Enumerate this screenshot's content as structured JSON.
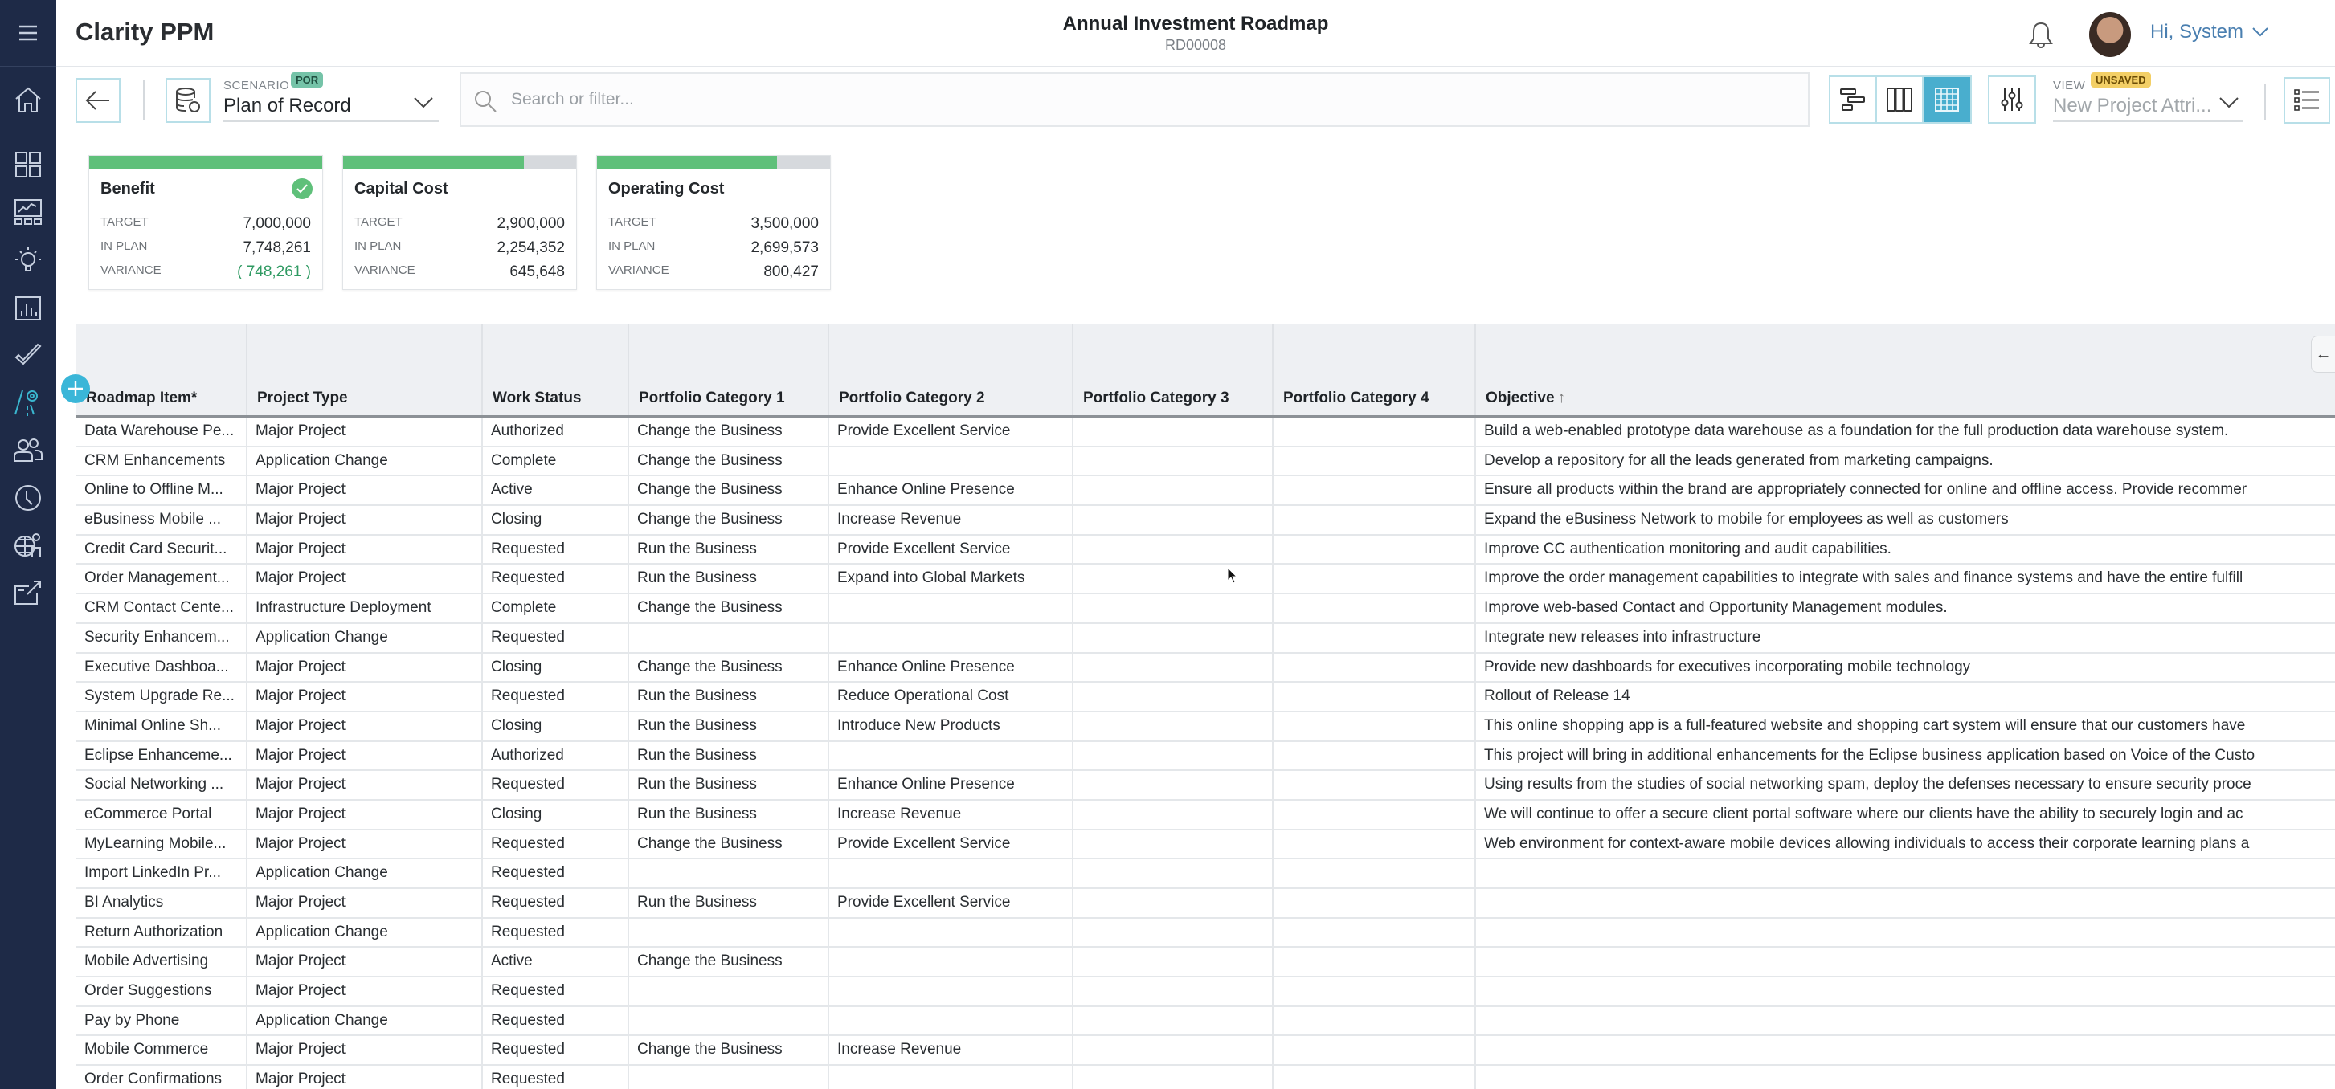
{
  "app": {
    "title": "Clarity PPM",
    "page_title": "Annual Investment Roadmap",
    "page_id": "RD00008",
    "user_greeting": "Hi, System"
  },
  "sidebar": {
    "items": [
      {
        "name": "home",
        "icon": "home-icon",
        "active": false
      },
      {
        "name": "boards",
        "icon": "grid-icon",
        "active": false
      },
      {
        "name": "dashboards",
        "icon": "dashboard-icon",
        "active": false
      },
      {
        "name": "ideas",
        "icon": "lightbulb-icon",
        "active": false
      },
      {
        "name": "reports",
        "icon": "bar-chart-icon",
        "active": false
      },
      {
        "name": "tasks",
        "icon": "checkmark-icon",
        "active": false
      },
      {
        "name": "roadmaps",
        "icon": "roadmap-icon",
        "active": true
      },
      {
        "name": "resources",
        "icon": "people-icon",
        "active": false
      },
      {
        "name": "timesheets",
        "icon": "clock-icon",
        "active": false
      },
      {
        "name": "global",
        "icon": "globe-person-icon",
        "active": false
      },
      {
        "name": "export",
        "icon": "export-icon",
        "active": false
      }
    ]
  },
  "toolbar": {
    "scenario_label": "SCENARIO",
    "scenario_badge": "POR",
    "scenario_value": "Plan of Record",
    "search_placeholder": "Search or filter...",
    "search_value": "",
    "view_label": "VIEW",
    "view_badge": "UNSAVED",
    "view_value": "New Project Attri...",
    "view_modes": [
      "timeline",
      "board",
      "grid"
    ],
    "active_view_mode": "grid"
  },
  "cards": [
    {
      "title": "Benefit",
      "progress_fraction": 1.0,
      "complete": true,
      "rows": [
        {
          "label": "TARGET",
          "value": "7,000,000"
        },
        {
          "label": "IN PLAN",
          "value": "7,748,261"
        },
        {
          "label": "VARIANCE",
          "value": "( 748,261 )",
          "positive": true
        }
      ]
    },
    {
      "title": "Capital Cost",
      "progress_fraction": 0.777,
      "complete": false,
      "rows": [
        {
          "label": "TARGET",
          "value": "2,900,000"
        },
        {
          "label": "IN PLAN",
          "value": "2,254,352"
        },
        {
          "label": "VARIANCE",
          "value": "645,648",
          "positive": false
        }
      ]
    },
    {
      "title": "Operating Cost",
      "progress_fraction": 0.771,
      "complete": false,
      "rows": [
        {
          "label": "TARGET",
          "value": "3,500,000"
        },
        {
          "label": "IN PLAN",
          "value": "2,699,573"
        },
        {
          "label": "VARIANCE",
          "value": "800,427",
          "positive": false
        }
      ]
    }
  ],
  "colors": {
    "sidebar_bg": "#1e2a47",
    "accent": "#3ab6d8",
    "progress_fill": "#5fc07a",
    "badge_por": "#75c3a8",
    "badge_unsaved": "#f3cf66",
    "variance_positive": "#2f9a62"
  },
  "table": {
    "columns": [
      "Roadmap Item*",
      "Project Type",
      "Work Status",
      "Portfolio Category 1",
      "Portfolio Category 2",
      "Portfolio Category 3",
      "Portfolio Category 4",
      "Objective"
    ],
    "sorted_column": "Objective",
    "sort_direction": "ascending",
    "rows": [
      [
        "Data Warehouse Pe...",
        "Major Project",
        "Authorized",
        "Change the Business",
        "Provide Excellent Service",
        "",
        "",
        "Build a web-enabled prototype data warehouse as a foundation for the full production data warehouse system."
      ],
      [
        "CRM Enhancements",
        "Application Change",
        "Complete",
        "Change the Business",
        "",
        "",
        "",
        "Develop a repository for all the leads generated from marketing campaigns."
      ],
      [
        "Online to Offline M...",
        "Major Project",
        "Active",
        "Change the Business",
        "Enhance Online Presence",
        "",
        "",
        "Ensure all products within the brand are appropriately connected for online and offline access. Provide recommer"
      ],
      [
        "eBusiness Mobile ...",
        "Major Project",
        "Closing",
        "Change the Business",
        "Increase Revenue",
        "",
        "",
        "Expand the eBusiness Network to mobile for employees as well as customers"
      ],
      [
        "Credit Card Securit...",
        "Major Project",
        "Requested",
        "Run the Business",
        "Provide Excellent Service",
        "",
        "",
        "Improve CC authentication monitoring and audit capabilities."
      ],
      [
        "Order Management...",
        "Major Project",
        "Requested",
        "Run the Business",
        "Expand into Global Markets",
        "",
        "",
        "Improve the order management capabilities to integrate with sales and finance systems and have the entire fulfill"
      ],
      [
        "CRM Contact Cente...",
        "Infrastructure Deployment",
        "Complete",
        "Change the Business",
        "",
        "",
        "",
        "Improve web-based Contact and Opportunity Management modules."
      ],
      [
        "Security Enhancem...",
        "Application Change",
        "Requested",
        "",
        "",
        "",
        "",
        "Integrate new releases into infrastructure"
      ],
      [
        "Executive Dashboa...",
        "Major Project",
        "Closing",
        "Change the Business",
        "Enhance Online Presence",
        "",
        "",
        "Provide new dashboards for executives incorporating mobile technology"
      ],
      [
        "System Upgrade Re...",
        "Major Project",
        "Requested",
        "Run the Business",
        "Reduce Operational Cost",
        "",
        "",
        "Rollout of Release 14"
      ],
      [
        "Minimal Online Sh...",
        "Major Project",
        "Closing",
        "Run the Business",
        "Introduce New Products",
        "",
        "",
        "This online shopping app is a full-featured website and shopping cart system will ensure that our customers have"
      ],
      [
        "Eclipse Enhanceme...",
        "Major Project",
        "Authorized",
        "Run the Business",
        "",
        "",
        "",
        "This project will bring in additional enhancements for the Eclipse business application based on Voice of the Custo"
      ],
      [
        "Social Networking ...",
        "Major Project",
        "Requested",
        "Run the Business",
        "Enhance Online Presence",
        "",
        "",
        "Using results from the studies of social networking spam, deploy the defenses necessary to ensure security proce"
      ],
      [
        "eCommerce Portal",
        "Major Project",
        "Closing",
        "Run the Business",
        "Increase Revenue",
        "",
        "",
        "We will continue to offer a secure client portal software where our clients have the ability to securely login and ac"
      ],
      [
        "MyLearning Mobile...",
        "Major Project",
        "Requested",
        "Change the Business",
        "Provide Excellent Service",
        "",
        "",
        "Web environment for context-aware mobile devices allowing individuals to access their corporate learning plans a"
      ],
      [
        "Import LinkedIn Pr...",
        "Application Change",
        "Requested",
        "",
        "",
        "",
        "",
        ""
      ],
      [
        "BI Analytics",
        "Major Project",
        "Requested",
        "Run the Business",
        "Provide Excellent Service",
        "",
        "",
        ""
      ],
      [
        "Return Authorization",
        "Application Change",
        "Requested",
        "",
        "",
        "",
        "",
        ""
      ],
      [
        "Mobile Advertising",
        "Major Project",
        "Active",
        "Change the Business",
        "",
        "",
        "",
        ""
      ],
      [
        "Order Suggestions",
        "Major Project",
        "Requested",
        "",
        "",
        "",
        "",
        ""
      ],
      [
        "Pay by Phone",
        "Application Change",
        "Requested",
        "",
        "",
        "",
        "",
        ""
      ],
      [
        "Mobile Commerce",
        "Major Project",
        "Requested",
        "Change the Business",
        "Increase Revenue",
        "",
        "",
        ""
      ],
      [
        "Order Confirmations",
        "Major Project",
        "Requested",
        "",
        "",
        "",
        "",
        ""
      ]
    ]
  }
}
